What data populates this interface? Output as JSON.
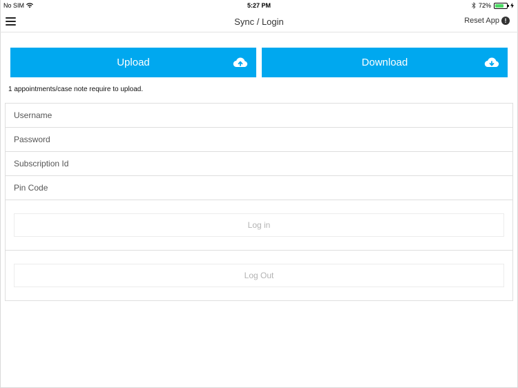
{
  "status_bar": {
    "carrier": "No SIM",
    "time": "5:27 PM",
    "battery_percent": "72%",
    "battery_level": 0.72,
    "icons": [
      "wifi-icon",
      "bluetooth-icon",
      "battery-icon",
      "charging-icon"
    ]
  },
  "nav": {
    "title": "Sync / Login",
    "reset_label": "Reset App",
    "reset_icon": "!"
  },
  "sync": {
    "upload_label": "Upload",
    "download_label": "Download",
    "accent_color": "#00a8ef",
    "notice": "1 appointments/case note require to upload."
  },
  "form": {
    "username_placeholder": "Username",
    "password_placeholder": "Password",
    "subscription_placeholder": "Subscription Id",
    "pin_placeholder": "Pin Code",
    "login_label": "Log in",
    "logout_label": "Log Out"
  }
}
